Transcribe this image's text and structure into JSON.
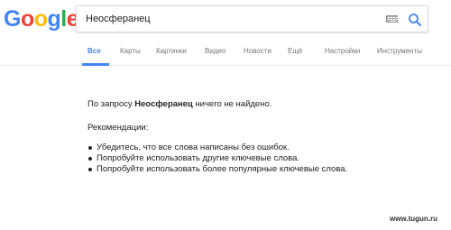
{
  "logo": {
    "text": "Google"
  },
  "search": {
    "query": "Неосферанец"
  },
  "tabs": [
    {
      "label": "Все"
    },
    {
      "label": "Карты"
    },
    {
      "label": "Картинки"
    },
    {
      "label": "Видео"
    },
    {
      "label": "Новости"
    },
    {
      "label": "Ещё"
    },
    {
      "label": "Настройки"
    },
    {
      "label": "Инструменты"
    }
  ],
  "results": {
    "prefix": "По запросу ",
    "query": "Неосферанец",
    "suffix": " ничего не найдено.",
    "recommendations_heading": "Рекомендации:",
    "recommendations": [
      "Убедитесь, что все слова написаны без ошибок.",
      "Попробуйте использовать другие ключевые слова.",
      "Попробуйте использовать более популярные ключевые слова."
    ]
  },
  "watermark": "www.tugun.ru"
}
